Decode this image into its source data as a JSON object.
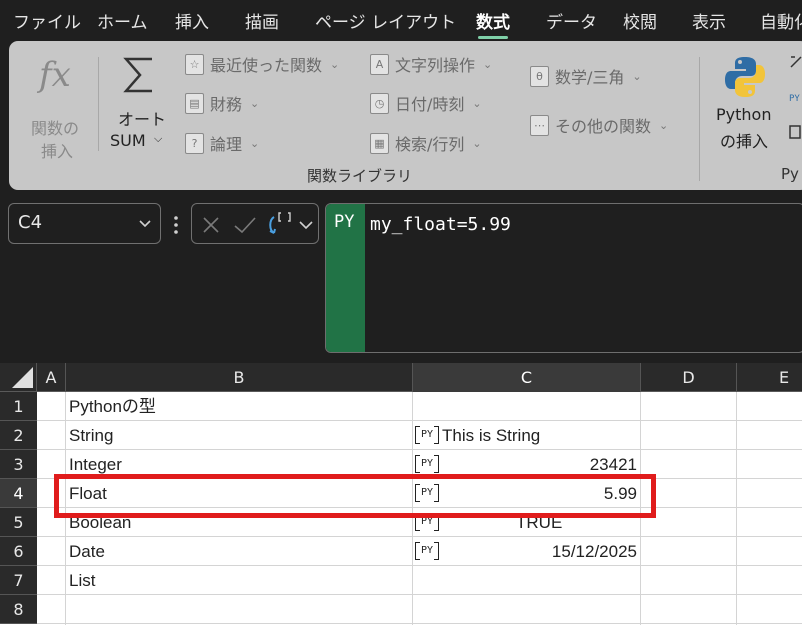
{
  "menu_tabs": [
    "ファイル",
    "ホーム",
    "挿入",
    "描画",
    "ページ レイアウト",
    "数式",
    "データ",
    "校閲",
    "表示",
    "自動化"
  ],
  "active_tab": "数式",
  "ribbon": {
    "insert_function": {
      "icon": "fx",
      "line1": "関数の",
      "line2": "挿入"
    },
    "autosum": {
      "line1": "オート",
      "line2": "SUM"
    },
    "small_buttons": [
      {
        "icon": "star-icon",
        "label": "最近使った関数"
      },
      {
        "icon": "finance-icon",
        "label": "財務"
      },
      {
        "icon": "logic-icon",
        "label": "論理"
      },
      {
        "icon": "text-icon",
        "label": "文字列操作"
      },
      {
        "icon": "clock-icon",
        "label": "日付/時刻"
      },
      {
        "icon": "lookup-icon",
        "label": "検索/行列"
      },
      {
        "icon": "math-icon",
        "label": "数学/三角"
      },
      {
        "icon": "more-functions-icon",
        "label": "その他の関数"
      }
    ],
    "group_label": "関数ライブラリ",
    "python": {
      "line1": "Python",
      "line2": "の挿入"
    },
    "group2_label_partial": "Py"
  },
  "formula_bar": {
    "name_box": "C4",
    "mode_label": "PY",
    "formula": "my_float=5.99",
    "icons": [
      "cancel-icon",
      "enter-icon",
      "python-object-icon",
      "chevron-down-icon"
    ]
  },
  "grid": {
    "columns": [
      "A",
      "B",
      "C",
      "D",
      "E"
    ],
    "selected_column": "C",
    "rows": [
      "1",
      "2",
      "3",
      "4",
      "5",
      "6",
      "7",
      "8"
    ],
    "selected_row": "4",
    "cells": {
      "B1": "Pythonの型",
      "B2": "String",
      "B3": "Integer",
      "B4": "Float",
      "B5": "Boolean",
      "B6": "Date",
      "B7": "List",
      "C2": "This is String",
      "C3": "23421",
      "C4": "5.99",
      "C5": "TRUE",
      "C6": "15/12/2025"
    },
    "py_icon_label": "PY",
    "highlight_color": "#e01c1c"
  },
  "colors": {
    "accent": "#217346",
    "tab_underline": "#7fd0a8"
  }
}
